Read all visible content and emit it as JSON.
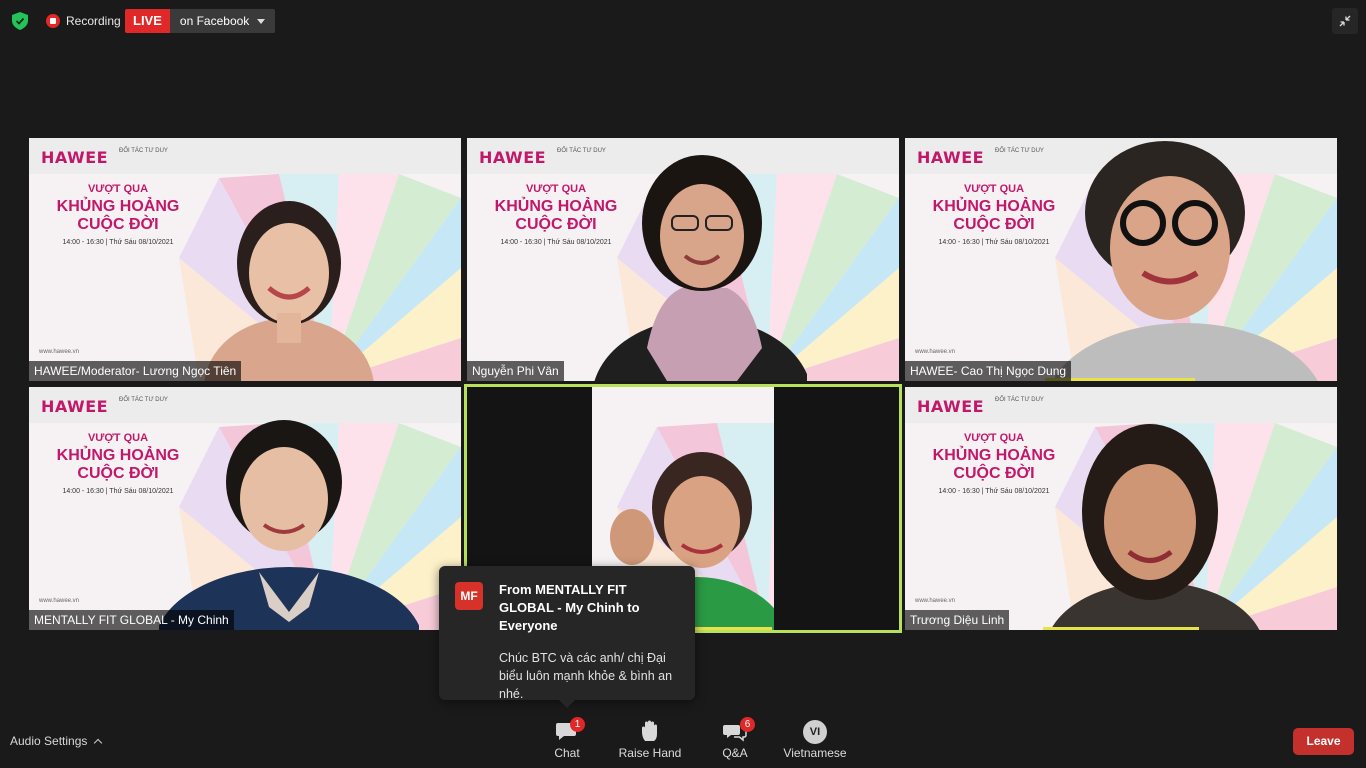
{
  "topbar": {
    "recording_label": "Recording",
    "live_label": "LIVE",
    "live_destination": "on Facebook"
  },
  "event": {
    "brand": "HAWEE",
    "sponsor_label": "ĐỐI TÁC TƯ DUY",
    "title_line1": "VƯỢT QUA",
    "title_line2": "KHỦNG HOẢNG",
    "title_line3": "CUỘC ĐỜI",
    "schedule": "14:00 - 16:30  |  Thứ Sáu 08/10/2021",
    "website": "www.hawee.vn"
  },
  "participants": [
    {
      "name": "HAWEE/Moderator- Lương Ngọc Tiên"
    },
    {
      "name": "Nguyễn Phi Vân"
    },
    {
      "name": "HAWEE- Cao Thị Ngọc Dung"
    },
    {
      "name": "MENTALLY FIT GLOBAL - My Chinh"
    },
    {
      "name": ""
    },
    {
      "name": "Trương Diệu Linh"
    }
  ],
  "toast": {
    "avatar_initials": "MF",
    "from": "From MENTALLY FIT GLOBAL - My Chinh to Everyone",
    "message": "Chúc BTC và các anh/ chị Đại biểu luôn mạnh khỏe & bình an nhé."
  },
  "bottombar": {
    "audio_settings": "Audio Settings",
    "chat_label": "Chat",
    "chat_badge": "1",
    "raise_hand_label": "Raise Hand",
    "qa_label": "Q&A",
    "qa_badge": "6",
    "language_initials": "VI",
    "language_label": "Vietnamese",
    "leave_label": "Leave"
  },
  "colors": {
    "accent_live": "#e02828",
    "speaker_outline": "#b9e05a",
    "brand_pink": "#c2186a",
    "leave_red": "#c4312c"
  }
}
